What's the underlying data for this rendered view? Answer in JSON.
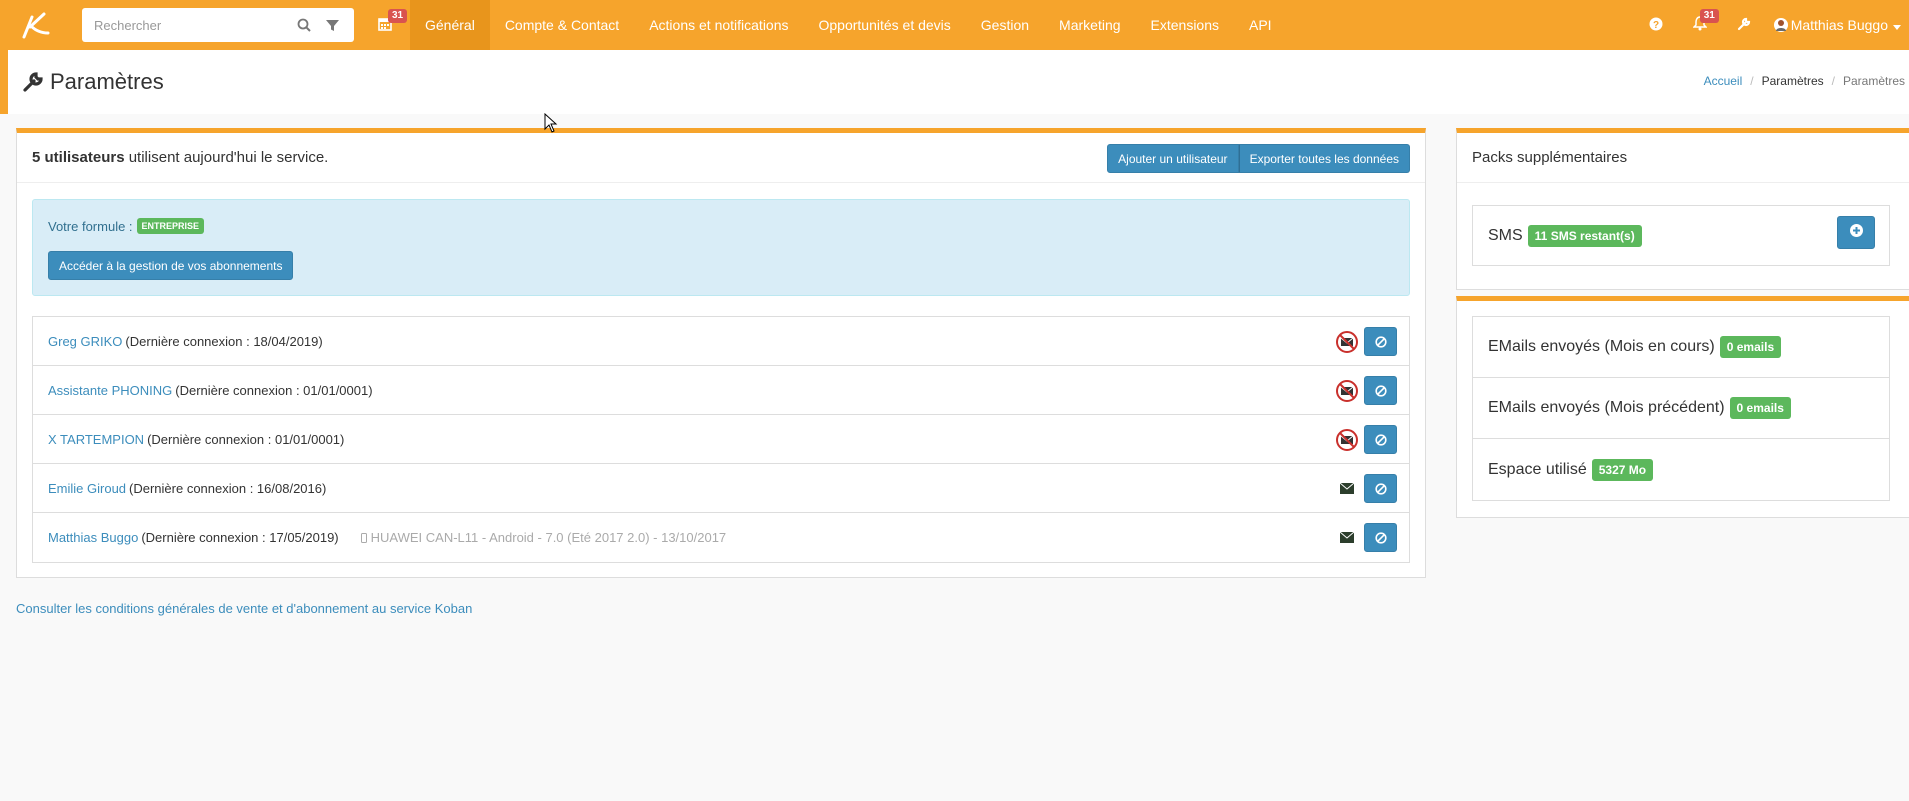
{
  "colors": {
    "brand": "#f6a42c",
    "primary": "#3c8dbc",
    "success": "#5cb85c",
    "danger": "#d9534f"
  },
  "navbar": {
    "search_placeholder": "Rechercher",
    "calendar_count": "31",
    "menu": [
      "Général",
      "Compte & Contact",
      "Actions et notifications",
      "Opportunités et devis",
      "Gestion",
      "Marketing",
      "Extensions",
      "API"
    ],
    "active_index": 0,
    "notifications_count": "31",
    "user_name": "Matthias Buggo"
  },
  "page": {
    "title": "Paramètres",
    "breadcrumb": [
      "Accueil",
      "Paramètres",
      "Paramètres"
    ]
  },
  "main": {
    "users_count_bold": "5 utilisateurs",
    "users_count_rest": " utilisent aujourd'hui le service.",
    "add_user_label": "Ajouter un utilisateur",
    "export_label": "Exporter toutes les données",
    "formula_label": "Votre formule :",
    "formula_value": "ENTREPRISE",
    "subscription_button": "Accéder à la gestion de vos abonnements",
    "users": [
      {
        "name": "Greg GRIKO",
        "last": "(Dernière connexion : 18/04/2019)",
        "device": "",
        "mail": "blocked"
      },
      {
        "name": "Assistante PHONING",
        "last": "(Dernière connexion : 01/01/0001)",
        "device": "",
        "mail": "blocked"
      },
      {
        "name": "X TARTEMPION",
        "last": "(Dernière connexion : 01/01/0001)",
        "device": "",
        "mail": "blocked"
      },
      {
        "name": "Emilie Giroud",
        "last": "(Dernière connexion : 16/08/2016)",
        "device": "",
        "mail": "ok"
      },
      {
        "name": "Matthias Buggo",
        "last": "(Dernière connexion : 17/05/2019)",
        "device": "HUAWEI CAN-L11 - Android - 7.0 (Eté 2017 2.0) - 13/10/2017",
        "mail": "ok"
      }
    ],
    "cgv_link": "Consulter les conditions générales de vente et d'abonnement au service Koban"
  },
  "packs": {
    "title": "Packs supplémentaires",
    "sms_label": "SMS",
    "sms_badge": "11 SMS restant(s)"
  },
  "stats": [
    {
      "label": "EMails envoyés (Mois en cours)",
      "value": "0 emails"
    },
    {
      "label": "EMails envoyés (Mois précédent)",
      "value": "0 emails"
    },
    {
      "label": "Espace utilisé",
      "value": "5327 Mo"
    }
  ]
}
